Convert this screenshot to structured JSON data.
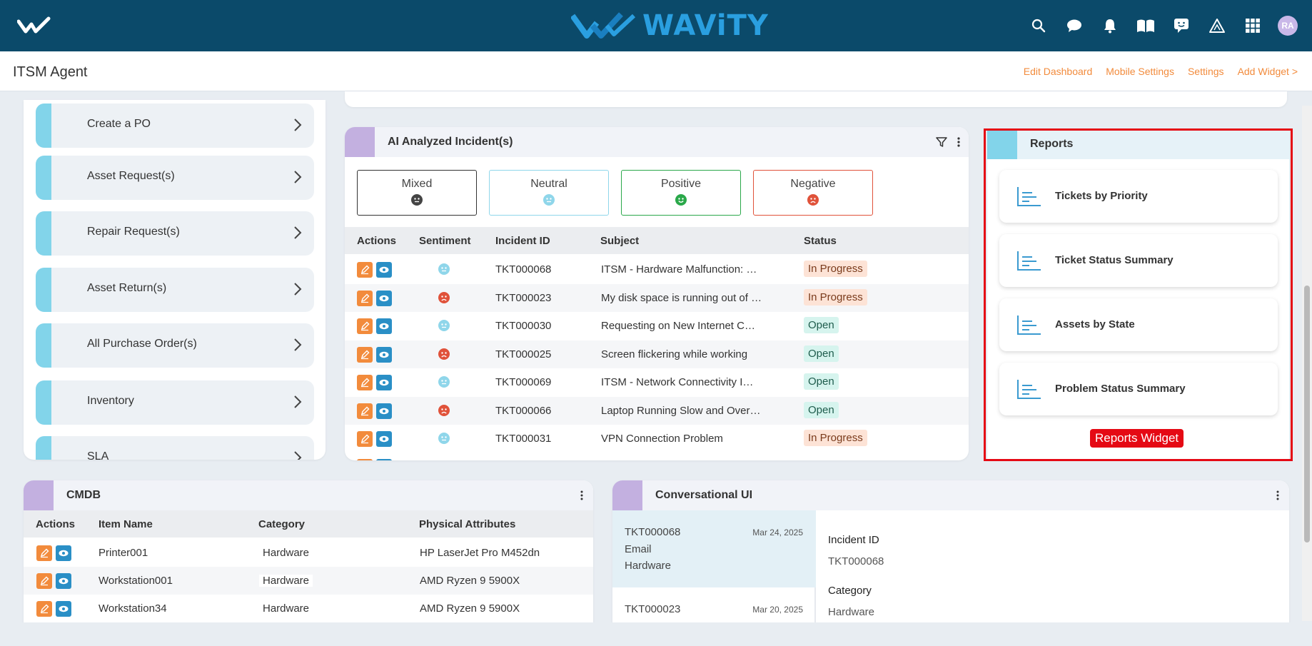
{
  "app": {
    "brand": "WAViTY",
    "page_title": "ITSM Agent",
    "avatar_initials": "RA",
    "accent_colors": {
      "topbar": "#0b4a6a",
      "brand": "#2a9fe0",
      "link": "#f28b3c",
      "highlight": "#e50914"
    }
  },
  "header_links": [
    "Edit Dashboard",
    "Mobile Settings",
    "Settings",
    "Add Widget >"
  ],
  "top_icons": [
    "search-icon",
    "chat-icon",
    "bell-icon",
    "book-icon",
    "feedback-icon",
    "warning-icon",
    "grid-icon"
  ],
  "quick_menu": [
    "Create a PO",
    "Asset Request(s)",
    "Repair Request(s)",
    "Asset Return(s)",
    "All Purchase Order(s)",
    "Inventory",
    "SLA"
  ],
  "ai_incidents": {
    "title": "AI Analyzed Incident(s)",
    "sentiments": [
      "Mixed",
      "Neutral",
      "Positive",
      "Negative"
    ],
    "columns": [
      "Actions",
      "Sentiment",
      "Incident ID",
      "Subject",
      "Status"
    ],
    "rows": [
      {
        "sentiment": "neutral",
        "id": "TKT000068",
        "subject": "ITSM - Hardware Malfunction: …",
        "status": "In Progress"
      },
      {
        "sentiment": "negative",
        "id": "TKT000023",
        "subject": "My disk space is running out of …",
        "status": "In Progress"
      },
      {
        "sentiment": "neutral",
        "id": "TKT000030",
        "subject": "Requesting on New Internet C…",
        "status": "Open"
      },
      {
        "sentiment": "negative",
        "id": "TKT000025",
        "subject": "Screen flickering while working",
        "status": "Open"
      },
      {
        "sentiment": "neutral",
        "id": "TKT000069",
        "subject": "ITSM - Network Connectivity I…",
        "status": "Open"
      },
      {
        "sentiment": "negative",
        "id": "TKT000066",
        "subject": "Laptop Running Slow and Over…",
        "status": "Open"
      },
      {
        "sentiment": "neutral",
        "id": "TKT000031",
        "subject": "VPN Connection Problem",
        "status": "In Progress"
      }
    ]
  },
  "reports": {
    "title": "Reports",
    "items": [
      "Tickets by Priority",
      "Ticket Status Summary",
      "Assets by State",
      "Problem Status Summary"
    ],
    "annotation": "Reports Widget"
  },
  "cmdb": {
    "title": "CMDB",
    "columns": [
      "Actions",
      "Item Name",
      "Category",
      "Physical Attributes"
    ],
    "rows": [
      {
        "name": "Printer001",
        "category": "Hardware",
        "attributes": "HP LaserJet Pro M452dn"
      },
      {
        "name": "Workstation001",
        "category": "Hardware",
        "attributes": "AMD Ryzen 9 5900X"
      },
      {
        "name": "Workstation34",
        "category": "Hardware",
        "attributes": "AMD Ryzen 9 5900X"
      }
    ]
  },
  "conversational": {
    "title": "Conversational UI",
    "list": [
      {
        "id": "TKT000068",
        "date": "Mar 24, 2025",
        "channel": "Email",
        "category": "Hardware"
      },
      {
        "id": "TKT000023",
        "date": "Mar 20, 2025"
      }
    ],
    "detail": {
      "incident_label": "Incident ID",
      "incident_value": "TKT000068",
      "category_label": "Category",
      "category_value": "Hardware"
    }
  }
}
